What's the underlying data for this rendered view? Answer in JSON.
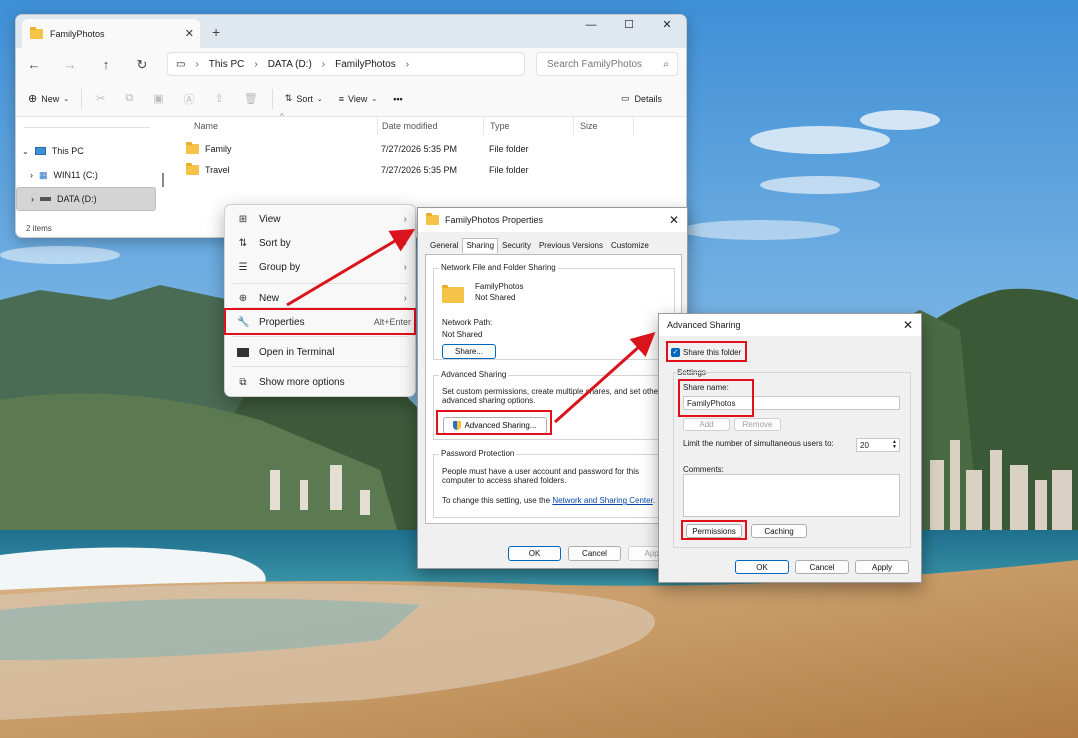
{
  "explorer": {
    "tab_title": "FamilyPhotos",
    "new_tab": "+",
    "window_buttons": [
      "—",
      "☐",
      "✕"
    ],
    "breadcrumb": [
      "This PC",
      "DATA (D:)",
      "FamilyPhotos"
    ],
    "search_placeholder": "Search FamilyPhotos",
    "commands": {
      "new": "New",
      "sort": "Sort",
      "view": "View",
      "more": "•••",
      "details": "Details"
    },
    "nav": [
      {
        "label": "This PC",
        "icon": "monitor-icon"
      },
      {
        "label": "WIN11 (C:)",
        "icon": "windows-drive-icon"
      },
      {
        "label": "DATA (D:)",
        "icon": "drive-icon"
      }
    ],
    "columns": [
      "Name",
      "Date modified",
      "Type",
      "Size"
    ],
    "files": [
      {
        "name": "Family",
        "date": "7/27/2026 5:35 PM",
        "type": "File folder",
        "size": ""
      },
      {
        "name": "Travel",
        "date": "7/27/2026 5:35 PM",
        "type": "File folder",
        "size": ""
      }
    ],
    "status": "2 items"
  },
  "context_menu": {
    "items": [
      {
        "label": "View",
        "icon": "grid-icon",
        "arrow": "›"
      },
      {
        "label": "Sort by",
        "icon": "sort-icon",
        "arrow": "›"
      },
      {
        "label": "Group by",
        "icon": "list-icon",
        "arrow": "›"
      },
      {
        "label": "New",
        "icon": "plus-circle-icon",
        "arrow": "›"
      },
      {
        "label": "Properties",
        "icon": "wrench-icon",
        "shortcut": "Alt+Enter"
      },
      {
        "label": "Open in Terminal",
        "icon": "terminal-icon"
      },
      {
        "label": "Show more options",
        "icon": "share-icon"
      }
    ]
  },
  "properties": {
    "title": "FamilyPhotos Properties",
    "tabs": [
      "General",
      "Sharing",
      "Security",
      "Previous Versions",
      "Customize"
    ],
    "active_tab": "Sharing",
    "network_group": "Network File and Folder Sharing",
    "folder_name": "FamilyPhotos",
    "share_state": "Not Shared",
    "network_path_label": "Network Path:",
    "network_path_value": "Not Shared",
    "share_button": "Share...",
    "advanced_group": "Advanced Sharing",
    "advanced_desc": "Set custom permissions, create multiple shares, and set other advanced sharing options.",
    "advanced_button": "Advanced Sharing...",
    "password_group": "Password Protection",
    "password_desc": "People must have a user account and password for this computer to access shared folders.",
    "password_change_prefix": "To change this setting, use the",
    "password_link": "Network and Sharing Center",
    "password_change_suffix": ".",
    "ok": "OK",
    "cancel": "Cancel",
    "apply": "Apply"
  },
  "advanced_sharing": {
    "title": "Advanced Sharing",
    "share_checkbox": "Share this folder",
    "settings_label": "Settings",
    "share_name_label": "Share name:",
    "share_name_value": "FamilyPhotos",
    "add": "Add",
    "remove": "Remove",
    "limit_label": "Limit the number of simultaneous users to:",
    "limit_value": "20",
    "comments_label": "Comments:",
    "permissions": "Permissions",
    "caching": "Caching",
    "ok": "OK",
    "cancel": "Cancel",
    "apply": "Apply"
  },
  "colors": {
    "highlight": "#e0101c",
    "accent": "#0067c0",
    "arrow": "#d9141c"
  }
}
